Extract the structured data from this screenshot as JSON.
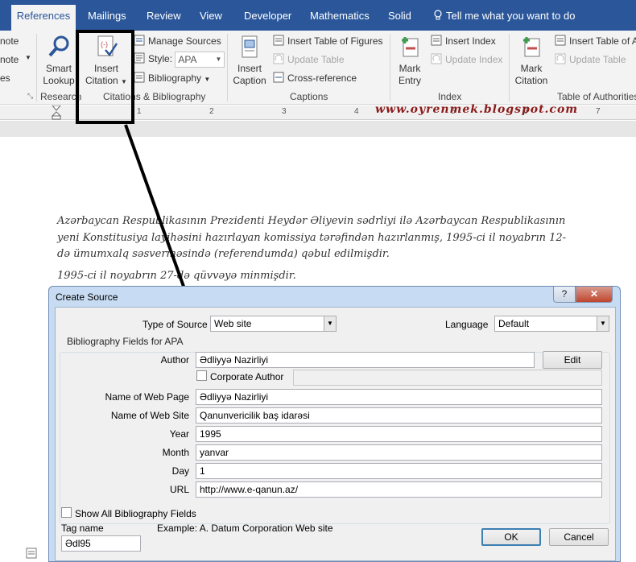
{
  "ribbon": {
    "tabs": [
      {
        "label": "References",
        "active": true
      },
      {
        "label": "Mailings"
      },
      {
        "label": "Review"
      },
      {
        "label": "View"
      },
      {
        "label": "Developer"
      },
      {
        "label": "Mathematics"
      },
      {
        "label": "Solid"
      }
    ],
    "tell_me": "Tell me what you want to do",
    "partial_left": [
      "note",
      "note",
      "es"
    ],
    "research": {
      "smart_lookup": [
        "Smart",
        "Lookup"
      ],
      "group_label": "Research"
    },
    "citations": {
      "insert_citation": [
        "Insert",
        "Citation"
      ],
      "manage_sources": "Manage Sources",
      "style_label": "Style:",
      "style_value": "APA",
      "bibliography": "Bibliography",
      "group_label": "Citations & Bibliography"
    },
    "captions": {
      "insert_caption": [
        "Insert",
        "Caption"
      ],
      "insert_table_of_figures": "Insert Table of Figures",
      "update_table": "Update Table",
      "cross_reference": "Cross-reference",
      "group_label": "Captions"
    },
    "index": {
      "mark_entry": [
        "Mark",
        "Entry"
      ],
      "insert_index": "Insert Index",
      "update_index": "Update Index",
      "group_label": "Index"
    },
    "authorities": {
      "mark_citation": [
        "Mark",
        "Citation"
      ],
      "insert_table": "Insert Table of A",
      "update_table": "Update Table",
      "group_label": "Table of Authorities"
    }
  },
  "ruler": {
    "numbers": [
      "1",
      "2",
      "3",
      "4",
      "5",
      "6",
      "7"
    ]
  },
  "watermark": "www.oyrenmek.blogspot.com",
  "document": {
    "paragraph1": "Azərbaycan Respublikasının Prezidenti Heydər Əliyevin sədrliyi ilə Azərbaycan Respublikasının yeni Konstitusiya layihəsini hazırlayan komissiya tərəfindən hazırlanmış, 1995-ci il noyabrın 12-də ümumxalq səsverməsində (referendumda) qəbul edilmişdir.",
    "paragraph2": "1995-ci il noyabrın 27-də qüvvəyə minmişdir."
  },
  "dialog": {
    "title": "Create Source",
    "help": "?",
    "close": "✕",
    "type_of_source_label": "Type of Source",
    "type_of_source_value": "Web site",
    "language_label": "Language",
    "language_value": "Default",
    "group_title": "Bibliography Fields for APA",
    "fields": {
      "author_label": "Author",
      "author_value": "Ədliyyə Nazirliyi",
      "edit_button": "Edit",
      "corporate_author_label": "Corporate Author",
      "web_page_label": "Name of Web Page",
      "web_page_value": "Ədliyyə Nazirliyi",
      "web_site_label": "Name of Web Site",
      "web_site_value": "Qanunvericilik baş idarəsi",
      "year_label": "Year",
      "year_value": "1995",
      "month_label": "Month",
      "month_value": "yanvar",
      "day_label": "Day",
      "day_value": "1",
      "url_label": "URL",
      "url_value": "http://www.e-qanun.az/"
    },
    "show_all_label": "Show All Bibliography Fields",
    "tag_name_label": "Tag name",
    "tag_name_value": "Ədl95",
    "example": "Example: A. Datum Corporation Web site",
    "ok": "OK",
    "cancel": "Cancel"
  },
  "colors": {
    "ribbon_blue": "#2b579a",
    "dialog_frame": "#c7dcf2",
    "callout": "#000000",
    "watermark": "#8b1a1a"
  }
}
